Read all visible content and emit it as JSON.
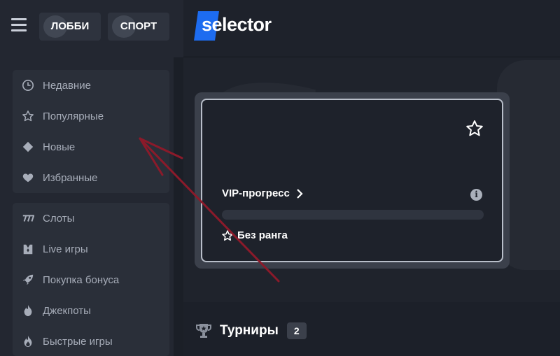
{
  "header": {
    "lobby_label": "ЛОББИ",
    "sport_label": "СПОРТ",
    "logo_text": "selector",
    "logo_color": "#1d6cf0"
  },
  "sidebar": {
    "group1": [
      {
        "label": "Недавние",
        "icon": "clock-icon"
      },
      {
        "label": "Популярные",
        "icon": "star-icon"
      },
      {
        "label": "Новые",
        "icon": "diamond-icon"
      },
      {
        "label": "Избранные",
        "icon": "heart-icon"
      }
    ],
    "group2": [
      {
        "label": "Слоты",
        "icon": "slots-icon"
      },
      {
        "label": "Live игры",
        "icon": "live-dealer-icon"
      },
      {
        "label": "Покупка бонуса",
        "icon": "rocket-icon"
      },
      {
        "label": "Джекпоты",
        "icon": "flame-icon"
      },
      {
        "label": "Быстрые игры",
        "icon": "quick-flame-icon"
      }
    ]
  },
  "vip_card": {
    "vip_label": "VIP-прогресс",
    "rank_label": "Без ранга",
    "progress_fraction": 0,
    "info_symbol": "i"
  },
  "tournaments": {
    "title": "Турниры",
    "count": "2"
  },
  "annotation": {
    "arrow_color": "#8b1a2a"
  }
}
